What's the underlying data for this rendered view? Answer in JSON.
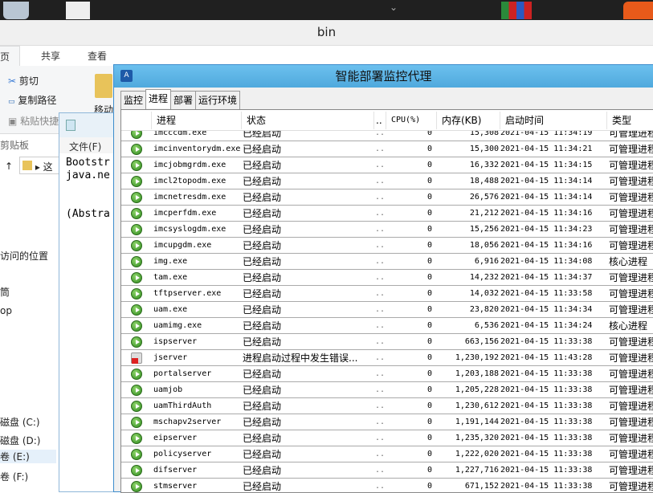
{
  "explorer": {
    "title": "bin",
    "tabs": [
      "页",
      "共享",
      "查看"
    ],
    "ribbon": {
      "cut": "剪切",
      "copy_path": "复制路径",
      "paste_shortcut": "粘贴快捷",
      "group": "剪贴板",
      "move": "移动"
    },
    "nav": [
      "访问的位置",
      "筒",
      "op",
      "磁盘 (C:)",
      "磁盘 (D:)",
      "卷 (E:)",
      "卷 (F:)"
    ],
    "address": "这"
  },
  "notepad": {
    "menu": "文件(F)",
    "lines": [
      "Bootstr",
      "java.ne",
      "",
      "",
      "(Abstra"
    ]
  },
  "agent": {
    "title": "智能部署监控代理",
    "tabs": [
      "监控",
      "进程",
      "部署",
      "运行环境"
    ],
    "active_tab": "进程",
    "columns": [
      "进程",
      "状态",
      "..",
      "CPU(%)",
      "内存(KB)",
      "启动时间",
      "类型"
    ],
    "rows": [
      {
        "name": "imcccdm.exe",
        "status": "已经启动",
        "dots": "...",
        "cpu": "0",
        "mem": "15,308",
        "time": "2021-04-15 11:34:19",
        "type": "可管理进程",
        "icon": "ok"
      },
      {
        "name": "imcinventorydm.exe",
        "status": "已经启动",
        "dots": "...",
        "cpu": "0",
        "mem": "15,300",
        "time": "2021-04-15 11:34:21",
        "type": "可管理进程",
        "icon": "ok"
      },
      {
        "name": "imcjobmgrdm.exe",
        "status": "已经启动",
        "dots": "...",
        "cpu": "0",
        "mem": "16,332",
        "time": "2021-04-15 11:34:15",
        "type": "可管理进程",
        "icon": "ok"
      },
      {
        "name": "imcl2topodm.exe",
        "status": "已经启动",
        "dots": "...",
        "cpu": "0",
        "mem": "18,488",
        "time": "2021-04-15 11:34:14",
        "type": "可管理进程",
        "icon": "ok"
      },
      {
        "name": "imcnetresdm.exe",
        "status": "已经启动",
        "dots": "...",
        "cpu": "0",
        "mem": "26,576",
        "time": "2021-04-15 11:34:14",
        "type": "可管理进程",
        "icon": "ok"
      },
      {
        "name": "imcperfdm.exe",
        "status": "已经启动",
        "dots": "...",
        "cpu": "0",
        "mem": "21,212",
        "time": "2021-04-15 11:34:16",
        "type": "可管理进程",
        "icon": "ok"
      },
      {
        "name": "imcsyslogdm.exe",
        "status": "已经启动",
        "dots": "...",
        "cpu": "0",
        "mem": "15,256",
        "time": "2021-04-15 11:34:23",
        "type": "可管理进程",
        "icon": "ok"
      },
      {
        "name": "imcupgdm.exe",
        "status": "已经启动",
        "dots": "...",
        "cpu": "0",
        "mem": "18,056",
        "time": "2021-04-15 11:34:16",
        "type": "可管理进程",
        "icon": "ok"
      },
      {
        "name": "img.exe",
        "status": "已经启动",
        "dots": "...",
        "cpu": "0",
        "mem": "6,916",
        "time": "2021-04-15 11:34:08",
        "type": "核心进程",
        "icon": "ok"
      },
      {
        "name": "tam.exe",
        "status": "已经启动",
        "dots": "...",
        "cpu": "0",
        "mem": "14,232",
        "time": "2021-04-15 11:34:37",
        "type": "可管理进程",
        "icon": "ok"
      },
      {
        "name": "tftpserver.exe",
        "status": "已经启动",
        "dots": "...",
        "cpu": "0",
        "mem": "14,032",
        "time": "2021-04-15 11:33:58",
        "type": "可管理进程",
        "icon": "ok"
      },
      {
        "name": "uam.exe",
        "status": "已经启动",
        "dots": "...",
        "cpu": "0",
        "mem": "23,820",
        "time": "2021-04-15 11:34:34",
        "type": "可管理进程",
        "icon": "ok"
      },
      {
        "name": "uamimg.exe",
        "status": "已经启动",
        "dots": "...",
        "cpu": "0",
        "mem": "6,536",
        "time": "2021-04-15 11:34:24",
        "type": "核心进程",
        "icon": "ok"
      },
      {
        "name": "ispserver",
        "status": "已经启动",
        "dots": "...",
        "cpu": "0",
        "mem": "663,156",
        "time": "2021-04-15 11:33:38",
        "type": "可管理进程",
        "icon": "ok"
      },
      {
        "name": "jserver",
        "status": "进程启动过程中发生错误...",
        "dots": "...",
        "cpu": "0",
        "mem": "1,230,192",
        "time": "2021-04-15 11:43:28",
        "type": "可管理进程",
        "icon": "error"
      },
      {
        "name": "portalserver",
        "status": "已经启动",
        "dots": "...",
        "cpu": "0",
        "mem": "1,203,188",
        "time": "2021-04-15 11:33:38",
        "type": "可管理进程",
        "icon": "ok"
      },
      {
        "name": "uamjob",
        "status": "已经启动",
        "dots": "...",
        "cpu": "0",
        "mem": "1,205,228",
        "time": "2021-04-15 11:33:38",
        "type": "可管理进程",
        "icon": "ok"
      },
      {
        "name": "uamThirdAuth",
        "status": "已经启动",
        "dots": "...",
        "cpu": "0",
        "mem": "1,230,612",
        "time": "2021-04-15 11:33:38",
        "type": "可管理进程",
        "icon": "ok"
      },
      {
        "name": "mschapv2server",
        "status": "已经启动",
        "dots": "...",
        "cpu": "0",
        "mem": "1,191,144",
        "time": "2021-04-15 11:33:38",
        "type": "可管理进程",
        "icon": "ok"
      },
      {
        "name": "eipserver",
        "status": "已经启动",
        "dots": "...",
        "cpu": "0",
        "mem": "1,235,320",
        "time": "2021-04-15 11:33:38",
        "type": "可管理进程",
        "icon": "ok"
      },
      {
        "name": "policyserver",
        "status": "已经启动",
        "dots": "...",
        "cpu": "0",
        "mem": "1,222,020",
        "time": "2021-04-15 11:33:38",
        "type": "可管理进程",
        "icon": "ok"
      },
      {
        "name": "difserver",
        "status": "已经启动",
        "dots": "...",
        "cpu": "0",
        "mem": "1,227,716",
        "time": "2021-04-15 11:33:38",
        "type": "可管理进程",
        "icon": "ok"
      },
      {
        "name": "stmserver",
        "status": "已经启动",
        "dots": "...",
        "cpu": "0",
        "mem": "671,152",
        "time": "2021-04-15 11:33:38",
        "type": "可管理进程",
        "icon": "ok"
      }
    ]
  }
}
